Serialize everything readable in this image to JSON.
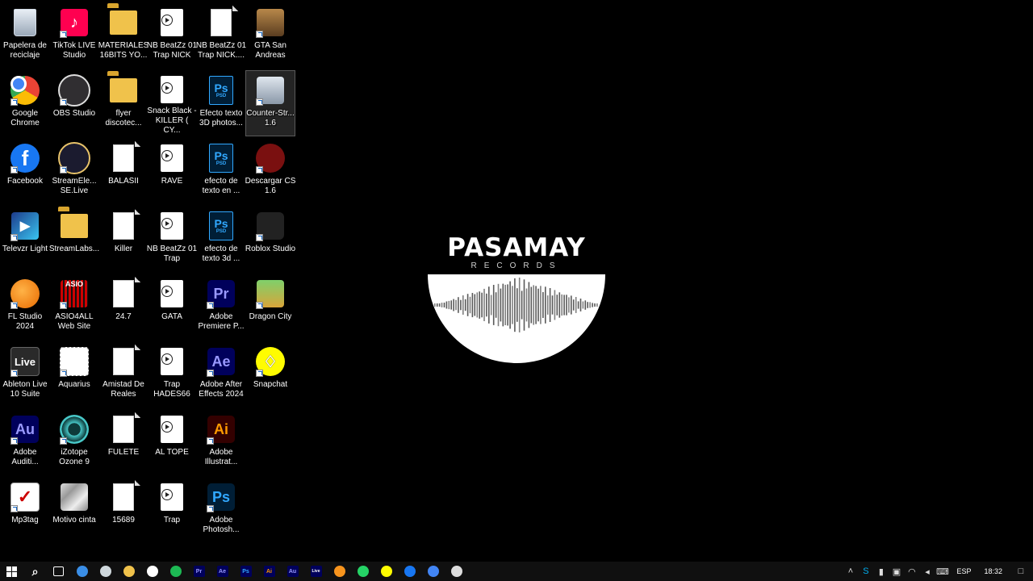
{
  "desktop": {
    "icons": [
      {
        "id": "recycle",
        "label": "Papelera de reciclaje",
        "col": 0,
        "row": 0,
        "icon": "recycle-bin-icon"
      },
      {
        "id": "tiktok",
        "label": "TikTok LIVE Studio",
        "col": 1,
        "row": 0,
        "icon": "tiktok-icon",
        "shortcut": true
      },
      {
        "id": "materiales",
        "label": "MATERIALES 16BITS YO...",
        "col": 2,
        "row": 0,
        "icon": "folder-icon"
      },
      {
        "id": "nb1",
        "label": "NB BeatZz 01 Trap NICK",
        "col": 3,
        "row": 0,
        "icon": "media-file-icon"
      },
      {
        "id": "nb2",
        "label": "NB BeatZz 01 Trap NICK....",
        "col": 4,
        "row": 0,
        "icon": "document-icon"
      },
      {
        "id": "gta",
        "label": "GTA San Andreas",
        "col": 5,
        "row": 0,
        "icon": "gta-icon",
        "shortcut": true
      },
      {
        "id": "chrome",
        "label": "Google Chrome",
        "col": 0,
        "row": 1,
        "icon": "chrome-icon",
        "shortcut": true
      },
      {
        "id": "obs",
        "label": "OBS Studio",
        "col": 1,
        "row": 1,
        "icon": "obs-icon",
        "shortcut": true
      },
      {
        "id": "flyer",
        "label": "flyer discotec...",
        "col": 2,
        "row": 1,
        "icon": "folder-icon"
      },
      {
        "id": "snack",
        "label": "Snack Black - KILLER ( CY...",
        "col": 3,
        "row": 1,
        "icon": "media-file-icon"
      },
      {
        "id": "efecto3d",
        "label": "Efecto texto 3D photos...",
        "col": 4,
        "row": 1,
        "icon": "psd-file-icon",
        "psd": "PSD"
      },
      {
        "id": "cs16",
        "label": "Counter-Str... 1.6",
        "col": 5,
        "row": 1,
        "icon": "counter-strike-icon",
        "shortcut": true,
        "selected": true
      },
      {
        "id": "facebook",
        "label": "Facebook",
        "col": 0,
        "row": 2,
        "icon": "facebook-icon",
        "shortcut": true
      },
      {
        "id": "streamelements",
        "label": "StreamEle... SE.Live",
        "col": 1,
        "row": 2,
        "icon": "streamelements-icon",
        "shortcut": true
      },
      {
        "id": "balasii",
        "label": "BALASII",
        "col": 2,
        "row": 2,
        "icon": "document-icon"
      },
      {
        "id": "rave",
        "label": "RAVE",
        "col": 3,
        "row": 2,
        "icon": "media-file-icon"
      },
      {
        "id": "efectoen",
        "label": "efecto de texto en ...",
        "col": 4,
        "row": 2,
        "icon": "psd-file-icon",
        "psd": "PSD"
      },
      {
        "id": "descargarcs",
        "label": "Descargar CS 1.6",
        "col": 5,
        "row": 2,
        "icon": "counter-strike-download-icon",
        "shortcut": true
      },
      {
        "id": "televzr",
        "label": "Televzr Light",
        "col": 0,
        "row": 3,
        "icon": "televzr-icon",
        "shortcut": true
      },
      {
        "id": "streamlabs",
        "label": "StreamLabs...",
        "col": 1,
        "row": 3,
        "icon": "folder-icon"
      },
      {
        "id": "killer",
        "label": "Killer",
        "col": 2,
        "row": 3,
        "icon": "document-icon"
      },
      {
        "id": "nbtrap",
        "label": "NB BeatZz 01 Trap",
        "col": 3,
        "row": 3,
        "icon": "media-file-icon"
      },
      {
        "id": "efecto3d2",
        "label": "efecto de texto 3d ...",
        "col": 4,
        "row": 3,
        "icon": "psd-file-icon",
        "psd": "PSD"
      },
      {
        "id": "roblox",
        "label": "Roblox Studio",
        "col": 5,
        "row": 3,
        "icon": "roblox-studio-icon",
        "shortcut": true
      },
      {
        "id": "flstudio",
        "label": "FL Studio 2024",
        "col": 0,
        "row": 4,
        "icon": "fl-studio-icon",
        "shortcut": true
      },
      {
        "id": "asio",
        "label": "ASIO4ALL Web Site",
        "col": 1,
        "row": 4,
        "icon": "asio4all-icon",
        "shortcut": true,
        "glyph": "ASIO"
      },
      {
        "id": "247",
        "label": "24.7",
        "col": 2,
        "row": 4,
        "icon": "document-icon"
      },
      {
        "id": "gata",
        "label": "GATA",
        "col": 3,
        "row": 4,
        "icon": "media-file-icon"
      },
      {
        "id": "premiere",
        "label": "Adobe Premiere P...",
        "col": 4,
        "row": 4,
        "icon": "premiere-pro-icon",
        "shortcut": true,
        "glyph": "Pr"
      },
      {
        "id": "dragoncity",
        "label": "Dragon City",
        "col": 5,
        "row": 4,
        "icon": "dragon-city-icon",
        "shortcut": true
      },
      {
        "id": "ableton",
        "label": "Ableton Live 10 Suite",
        "col": 0,
        "row": 5,
        "icon": "ableton-live-icon",
        "shortcut": true,
        "glyph": "Live"
      },
      {
        "id": "aquarius",
        "label": "Aquarius",
        "col": 1,
        "row": 5,
        "icon": "aquarius-icon",
        "shortcut": true
      },
      {
        "id": "amistad",
        "label": "Amistad De Reales",
        "col": 2,
        "row": 5,
        "icon": "document-icon"
      },
      {
        "id": "traphades",
        "label": "Trap HADES66",
        "col": 3,
        "row": 5,
        "icon": "media-file-icon"
      },
      {
        "id": "aftereffects",
        "label": "Adobe After Effects 2024",
        "col": 4,
        "row": 5,
        "icon": "after-effects-icon",
        "shortcut": true,
        "glyph": "Ae"
      },
      {
        "id": "snapchat",
        "label": "Snapchat",
        "col": 5,
        "row": 5,
        "icon": "snapchat-icon",
        "shortcut": true
      },
      {
        "id": "audition",
        "label": "Adobe Auditi...",
        "col": 0,
        "row": 6,
        "icon": "audition-icon",
        "shortcut": true,
        "glyph": "Au"
      },
      {
        "id": "ozone",
        "label": "iZotope Ozone 9",
        "col": 1,
        "row": 6,
        "icon": "ozone-icon",
        "shortcut": true
      },
      {
        "id": "fulete",
        "label": "FULETE",
        "col": 2,
        "row": 6,
        "icon": "document-icon"
      },
      {
        "id": "altope",
        "label": "AL TOPE",
        "col": 3,
        "row": 6,
        "icon": "media-file-icon"
      },
      {
        "id": "illustrator",
        "label": "Adobe Illustrat...",
        "col": 4,
        "row": 6,
        "icon": "illustrator-icon",
        "shortcut": true,
        "glyph": "Ai"
      },
      {
        "id": "mp3tag",
        "label": "Mp3tag",
        "col": 0,
        "row": 7,
        "icon": "mp3tag-icon",
        "shortcut": true
      },
      {
        "id": "motivo",
        "label": "Motivo cinta",
        "col": 1,
        "row": 7,
        "icon": "image-file-icon"
      },
      {
        "id": "15689",
        "label": "15689",
        "col": 2,
        "row": 7,
        "icon": "document-icon"
      },
      {
        "id": "trap",
        "label": "Trap",
        "col": 3,
        "row": 7,
        "icon": "media-file-icon"
      },
      {
        "id": "photoshop",
        "label": "Adobe Photosh...",
        "col": 4,
        "row": 7,
        "icon": "photoshop-icon",
        "shortcut": true,
        "glyph": "Ps"
      }
    ]
  },
  "wallpaper": {
    "title": "PASAMAY",
    "subtitle": "RECORDS"
  },
  "taskbar": {
    "items": [
      {
        "id": "start",
        "icon": "windows-start-icon",
        "color": "#ffffff"
      },
      {
        "id": "search",
        "icon": "search-icon",
        "color": "#ffffff"
      },
      {
        "id": "taskview",
        "icon": "task-view-icon",
        "color": "#ffffff"
      },
      {
        "id": "edge",
        "icon": "edge-icon",
        "color": "#3a8ee6"
      },
      {
        "id": "mail",
        "icon": "mail-icon",
        "color": "#cfd8dc"
      },
      {
        "id": "explorer",
        "icon": "file-explorer-icon",
        "color": "#f0c24b"
      },
      {
        "id": "media",
        "icon": "media-player-icon",
        "color": "#ffffff"
      },
      {
        "id": "spotify",
        "icon": "spotify-icon",
        "color": "#1db954"
      },
      {
        "id": "premiere",
        "icon": "premiere-pro-icon",
        "color": "#9999ff",
        "glyph": "Pr"
      },
      {
        "id": "ae",
        "icon": "after-effects-icon",
        "color": "#9999ff",
        "glyph": "Ae"
      },
      {
        "id": "ps",
        "icon": "photoshop-icon",
        "color": "#31a8ff",
        "glyph": "Ps"
      },
      {
        "id": "ai",
        "icon": "illustrator-icon",
        "color": "#ff9a00",
        "glyph": "Ai"
      },
      {
        "id": "au",
        "icon": "audition-icon",
        "color": "#9999ff",
        "glyph": "Au"
      },
      {
        "id": "ableton",
        "icon": "ableton-live-icon",
        "color": "#ffffff",
        "glyph": "Live"
      },
      {
        "id": "fl",
        "icon": "fl-studio-icon",
        "color": "#f7941d"
      },
      {
        "id": "whatsapp",
        "icon": "whatsapp-icon",
        "color": "#25d366"
      },
      {
        "id": "snapchat",
        "icon": "snapchat-icon",
        "color": "#fffc00"
      },
      {
        "id": "facebook",
        "icon": "facebook-icon",
        "color": "#1877f2"
      },
      {
        "id": "chrome",
        "icon": "chrome-icon",
        "color": "#4285f4"
      },
      {
        "id": "obs",
        "icon": "obs-icon",
        "color": "#dddddd"
      }
    ],
    "tray": [
      {
        "id": "chevron",
        "icon": "chevron-up-icon"
      },
      {
        "id": "skype",
        "icon": "skype-icon"
      },
      {
        "id": "mic",
        "icon": "microphone-icon"
      },
      {
        "id": "defender",
        "icon": "shield-icon"
      },
      {
        "id": "wifi",
        "icon": "wifi-icon"
      },
      {
        "id": "volume",
        "icon": "volume-icon"
      },
      {
        "id": "keyboard",
        "icon": "keyboard-icon"
      }
    ],
    "language": "ESP",
    "clock": "18:32",
    "notifications_icon": "notifications-icon"
  }
}
